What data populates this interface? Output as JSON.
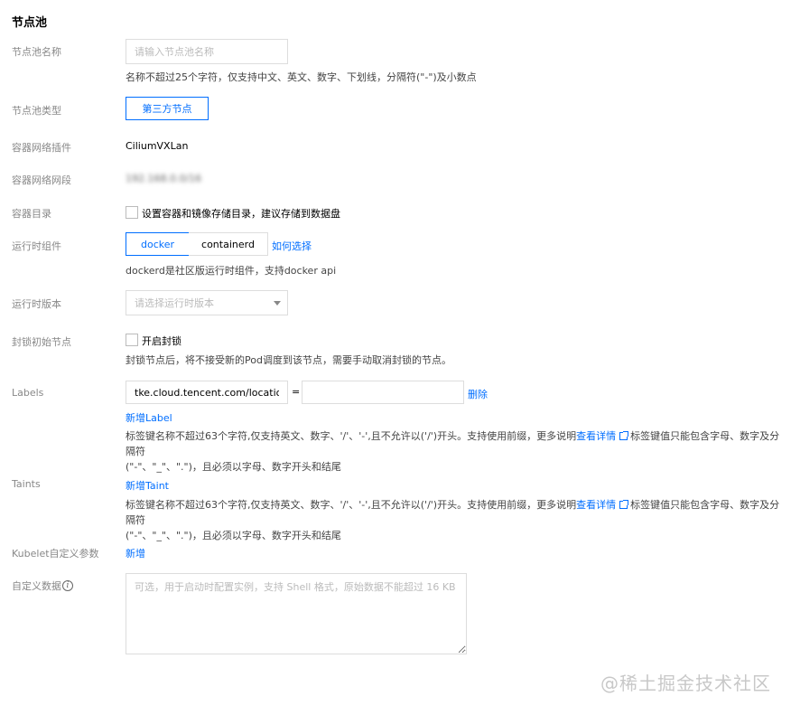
{
  "section": {
    "title": "节点池"
  },
  "pool_name": {
    "label": "节点池名称",
    "placeholder": "请输入节点池名称",
    "hint": "名称不超过25个字符，仅支持中文、英文、数字、下划线，分隔符(\"-\")及小数点"
  },
  "pool_type": {
    "label": "节点池类型",
    "option": "第三方节点"
  },
  "network_plugin": {
    "label": "容器网络插件",
    "value": "CiliumVXLan"
  },
  "network_cidr": {
    "label": "容器网络网段",
    "value": "192.168.0.0/16"
  },
  "container_dir": {
    "label": "容器目录",
    "checkbox_label": "设置容器和镜像存储目录，建议存储到数据盘"
  },
  "runtime": {
    "label": "运行时组件",
    "options": [
      "docker",
      "containerd"
    ],
    "help_link": "如何选择",
    "hint": "dockerd是社区版运行时组件，支持docker api"
  },
  "runtime_version": {
    "label": "运行时版本",
    "placeholder": "请选择运行时版本"
  },
  "cordon": {
    "label": "封锁初始节点",
    "checkbox_label": "开启封锁",
    "hint": "封锁节点后，将不接受新的Pod调度到该节点，需要手动取消封锁的节点。"
  },
  "labels": {
    "label": "Labels",
    "key": "tke.cloud.tencent.com/location",
    "equals": "=",
    "value": "",
    "delete": "删除",
    "add": "新增Label",
    "hint_line1_a": "标签键名称不超过63个字符,仅支持英文、数字、'/'、'-',且不允许以('/')开头。支持使用前缀，更多说明",
    "hint_link": "查看详情",
    "hint_line1_b": "标签键值只能包含字母、数字及分隔符",
    "hint_line2": "(\"-\"、\"_\"、\".\")，且必须以字母、数字开头和结尾"
  },
  "taints": {
    "label": "Taints",
    "add": "新增Taint",
    "hint_line1_a": "标签键名称不超过63个字符,仅支持英文、数字、'/'、'-',且不允许以('/')开头。支持使用前缀，更多说明",
    "hint_link": "查看详情",
    "hint_line1_b": "标签键值只能包含字母、数字及分隔符",
    "hint_line2": "(\"-\"、\"_\"、\".\")，且必须以字母、数字开头和结尾"
  },
  "kubelet": {
    "label": "Kubelet自定义参数",
    "add": "新增"
  },
  "user_data": {
    "label": "自定义数据",
    "icon": "info-icon",
    "placeholder": "可选，用于启动时配置实例，支持 Shell 格式，原始数据不能超过 16 KB"
  },
  "watermark": "@稀土掘金技术社区",
  "colors": {
    "accent": "#006eff",
    "label": "#888888",
    "border": "#dddddd"
  }
}
